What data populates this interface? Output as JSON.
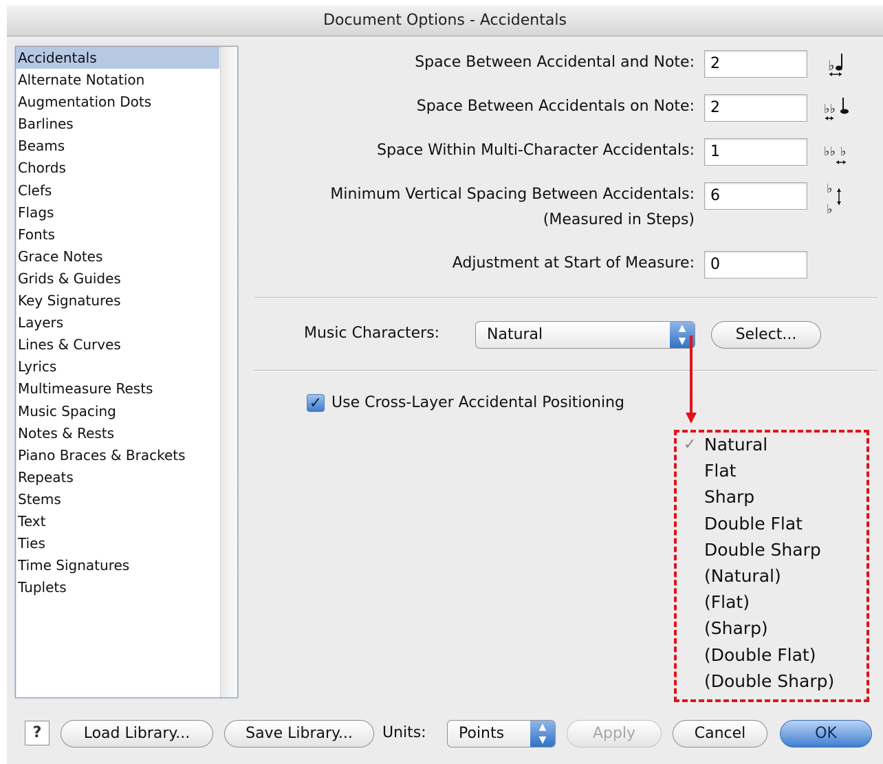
{
  "window": {
    "title": "Document Options - Accidentals"
  },
  "sidebar": {
    "items": [
      {
        "label": "Accidentals",
        "selected": true
      },
      {
        "label": "Alternate Notation"
      },
      {
        "label": "Augmentation Dots"
      },
      {
        "label": "Barlines"
      },
      {
        "label": "Beams"
      },
      {
        "label": "Chords"
      },
      {
        "label": "Clefs"
      },
      {
        "label": "Flags"
      },
      {
        "label": "Fonts"
      },
      {
        "label": "Grace Notes"
      },
      {
        "label": "Grids & Guides"
      },
      {
        "label": "Key Signatures"
      },
      {
        "label": "Layers"
      },
      {
        "label": "Lines & Curves"
      },
      {
        "label": "Lyrics"
      },
      {
        "label": "Multimeasure Rests"
      },
      {
        "label": "Music Spacing"
      },
      {
        "label": "Notes & Rests"
      },
      {
        "label": "Piano Braces & Brackets"
      },
      {
        "label": "Repeats"
      },
      {
        "label": "Stems"
      },
      {
        "label": "Text"
      },
      {
        "label": "Ties"
      },
      {
        "label": "Time Signatures"
      },
      {
        "label": "Tuplets"
      }
    ]
  },
  "fields": {
    "space_accidental_note": {
      "label": "Space Between Accidental and Note:",
      "value": "2",
      "icon": "accidental-note-spacing-icon"
    },
    "space_accidentals_on_note": {
      "label": "Space Between Accidentals on Note:",
      "value": "2",
      "icon": "accidentals-on-note-spacing-icon"
    },
    "space_multi_char": {
      "label": "Space Within Multi-Character Accidentals:",
      "value": "1",
      "icon": "multi-character-spacing-icon"
    },
    "min_vertical_spacing": {
      "label": "Minimum Vertical Spacing Between Accidentals:",
      "sublabel": "(Measured in Steps)",
      "value": "6",
      "icon": "vertical-spacing-icon"
    },
    "adjustment_start": {
      "label": "Adjustment at Start of Measure:",
      "value": "0"
    }
  },
  "music_characters": {
    "label": "Music Characters:",
    "selected": "Natural",
    "select_button": "Select..."
  },
  "cross_layer": {
    "label": "Use Cross-Layer Accidental Positioning",
    "checked": true
  },
  "dropdown_options": [
    "Natural",
    "Flat",
    "Sharp",
    "Double Flat",
    "Double Sharp",
    "(Natural)",
    "(Flat)",
    "(Sharp)",
    "(Double Flat)",
    "(Double Sharp)"
  ],
  "dropdown_checkmark": "✓",
  "footer": {
    "help": "?",
    "load_library": "Load Library...",
    "save_library": "Save Library...",
    "units_label": "Units:",
    "units_value": "Points",
    "apply": "Apply",
    "cancel": "Cancel",
    "ok": "OK"
  },
  "colors": {
    "annotation": "#e0121a",
    "selection": "#b5c8e4",
    "default_button": "#3f7fd0"
  }
}
